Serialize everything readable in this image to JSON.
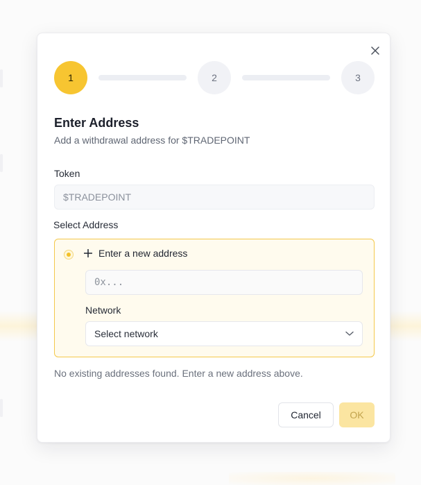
{
  "modal": {
    "steps": [
      "1",
      "2",
      "3"
    ],
    "active_step": 1,
    "title": "Enter Address",
    "subtitle": "Add a withdrawal address for $TRADEPOINT",
    "token_label": "Token",
    "token_value": "$TRADEPOINT",
    "select_address_label": "Select Address",
    "new_address_label": "Enter a new address",
    "address_placeholder": "0x...",
    "network_label": "Network",
    "network_placeholder": "Select network",
    "empty_note": "No existing addresses found. Enter a new address above.",
    "cancel_label": "Cancel",
    "ok_label": "OK"
  },
  "colors": {
    "accent": "#f7c531",
    "accent_soft": "#fffbee",
    "ok_disabled": "#fbe5a1",
    "step_inactive": "#f1f2f6"
  },
  "icons": {
    "close": "close-icon",
    "plus": "plus-icon",
    "chevron": "chevron-down-icon"
  }
}
